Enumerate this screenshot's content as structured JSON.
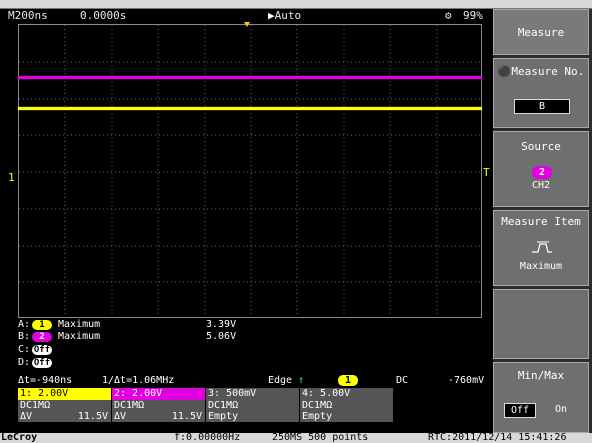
{
  "status": {
    "timebase": "M200ns",
    "delay": "0.0000s",
    "mode": "Auto",
    "mode_icon": "play-icon",
    "battery_icon": "gear-icon",
    "battery_pct": "99%"
  },
  "trace_labels": {
    "left_marker": "1",
    "right_marker": "T"
  },
  "measurements": [
    {
      "id": "A:",
      "channel": "1",
      "name": "Maximum",
      "value": "3.39V",
      "state": "ch1"
    },
    {
      "id": "B:",
      "channel": "2",
      "name": "Maximum",
      "value": "5.06V",
      "state": "ch2"
    },
    {
      "id": "C:",
      "channel": "Off",
      "name": "",
      "value": "",
      "state": "off"
    },
    {
      "id": "D:",
      "channel": "Off",
      "name": "",
      "value": "",
      "state": "off"
    }
  ],
  "trigger": {
    "delta_t": "Δt=-940ns",
    "inv_delta_t": "1/Δt=1.06MHz",
    "type": "Edge",
    "source": "1",
    "coupling": "DC",
    "level": "-760mV"
  },
  "channels": [
    {
      "label": "1: 2.00V",
      "coupling": "DC1MΩ",
      "dv_label": "ΔV",
      "dv_value": "11.5V",
      "color": "#ffff00",
      "text": "#000000"
    },
    {
      "label": "2: 2.00V",
      "coupling": "DC1MΩ",
      "dv_label": "ΔV",
      "dv_value": "11.5V",
      "color": "#e000e0",
      "text": "#ffffff"
    },
    {
      "label": "3: 500mV",
      "coupling": "DC1MΩ",
      "dv_label": "Empty",
      "dv_value": "",
      "color": "#555555",
      "text": "#ffffff"
    },
    {
      "label": "4: 5.00V",
      "coupling": "DC1MΩ",
      "dv_label": "Empty",
      "dv_value": "",
      "color": "#555555",
      "text": "#ffffff"
    }
  ],
  "footer": {
    "brand": "LeCroy",
    "frequency": "f:0.00000Hz",
    "sample": "250MS 500 points",
    "clock": "RTC:2011/12/14 15:41:26"
  },
  "panel": {
    "title": "Measure",
    "measure_no_label": "Measure No.",
    "measure_no_value": "B",
    "source_label": "Source",
    "source_channel": "2",
    "source_name": "CH2",
    "item_label": "Measure Item",
    "item_icon": "pulse-max-icon",
    "item_name": "Maximum",
    "minmax_label": "Min/Max",
    "off_label": "Off",
    "on_label": "On"
  }
}
